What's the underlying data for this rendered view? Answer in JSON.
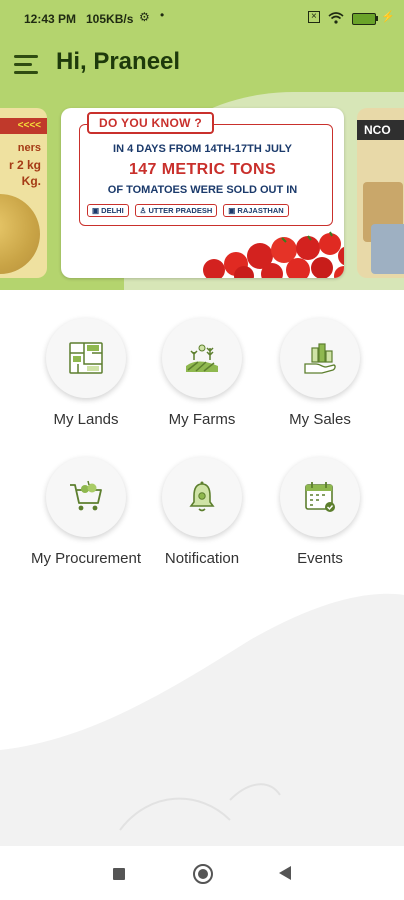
{
  "status_bar": {
    "time": "12:43 PM",
    "network_speed": "105KB/s",
    "battery_level": "100"
  },
  "header": {
    "greeting": "Hi, Praneel"
  },
  "banners": {
    "left": {
      "ribbon": "<<<<",
      "line1": "ners",
      "line2": "r 2 kg",
      "line3": "Kg."
    },
    "main": {
      "badge": "DO YOU KNOW ?",
      "line1": "IN 4 DAYS FROM 14TH-17TH JULY",
      "line2": "147 METRIC TONS",
      "line3": "OF TOMATOES WERE SOLD OUT IN",
      "states": [
        "DELHI",
        "UTTER PRADESH",
        "RAJASTHAN"
      ]
    },
    "right": {
      "tag": "NCO"
    }
  },
  "tiles": [
    {
      "label": "My Lands",
      "icon": "land-map-icon"
    },
    {
      "label": "My Farms",
      "icon": "farm-field-icon"
    },
    {
      "label": "My Sales",
      "icon": "sales-hand-icon"
    },
    {
      "label": "My Procurement",
      "icon": "procurement-cart-icon"
    },
    {
      "label": "Notification",
      "icon": "bell-icon"
    },
    {
      "label": "Events",
      "icon": "calendar-icon"
    }
  ],
  "colors": {
    "header_bg": "#b4d46e",
    "accent_green": "#6aa329",
    "dark_green": "#1e3a0b",
    "banner_red": "#c9302c",
    "banner_blue": "#1b3a6b"
  }
}
